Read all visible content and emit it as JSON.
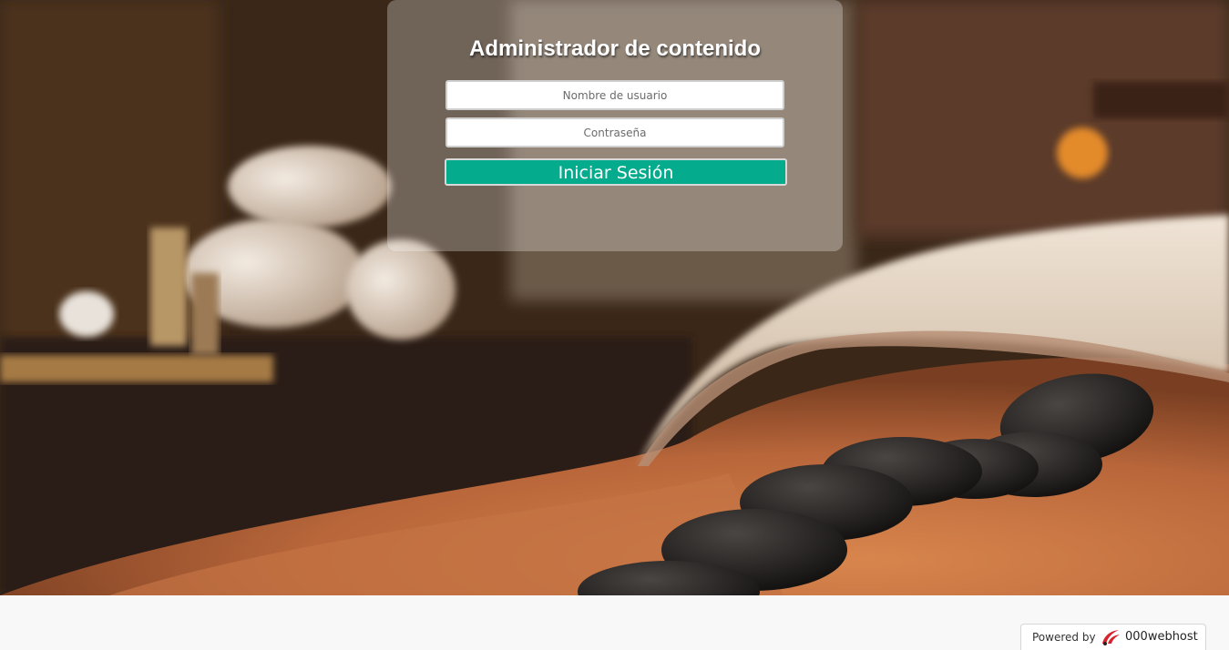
{
  "login": {
    "title": "Administrador de contenido",
    "username_placeholder": "Nombre de usuario",
    "password_placeholder": "Contraseña",
    "submit_label": "Iniciar Sesión"
  },
  "footer": {
    "powered_by": "Powered by",
    "brand": "000webhost"
  },
  "colors": {
    "accent": "#05ab8d",
    "brand_red": "#d8232a"
  },
  "background": {
    "image": "spa hot stone massage photo"
  }
}
